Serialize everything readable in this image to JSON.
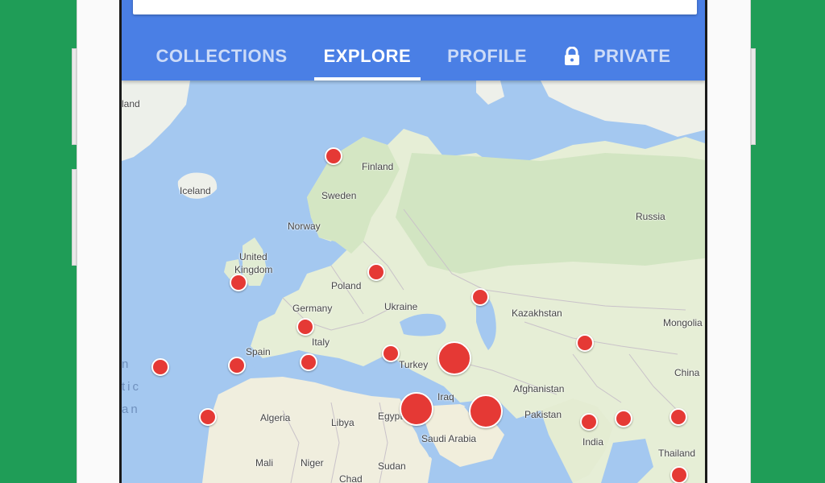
{
  "tabs": [
    {
      "label": "COLLECTIONS",
      "active": false
    },
    {
      "label": "EXPLORE",
      "active": true
    },
    {
      "label": "PROFILE",
      "active": false
    },
    {
      "label": "PRIVATE",
      "active": false,
      "icon": "lock-icon"
    }
  ],
  "map_labels": {
    "finland": "Finland",
    "iceland": "Iceland",
    "sweden": "Sweden",
    "norway": "Norway",
    "russia": "Russia",
    "united_kingdom_1": "United",
    "united_kingdom_2": "Kingdom",
    "poland": "Poland",
    "germany": "Germany",
    "ukraine": "Ukraine",
    "kazakhstan": "Kazakhstan",
    "mongolia": "Mongolia",
    "spain": "Spain",
    "italy": "Italy",
    "turkey": "Turkey",
    "china": "China",
    "afghanistan": "Afghanistan",
    "iraq": "Iraq",
    "algeria": "Algeria",
    "libya": "Libya",
    "egypt": "Egypt",
    "pakistan": "Pakistan",
    "saudi_arabia": "Saudi Arabia",
    "india": "India",
    "mali": "Mali",
    "niger": "Niger",
    "sudan": "Sudan",
    "thailand": "Thailand",
    "chad": "Chad",
    "fragment_land": "land",
    "ocean_1": "n",
    "ocean_2": "tic",
    "ocean_3": "an"
  },
  "colors": {
    "appbar": "#4a7fe5",
    "marker": "#e53935",
    "water": "#a4c8f0",
    "land": "#e9eedc",
    "background": "#1f9d57"
  }
}
